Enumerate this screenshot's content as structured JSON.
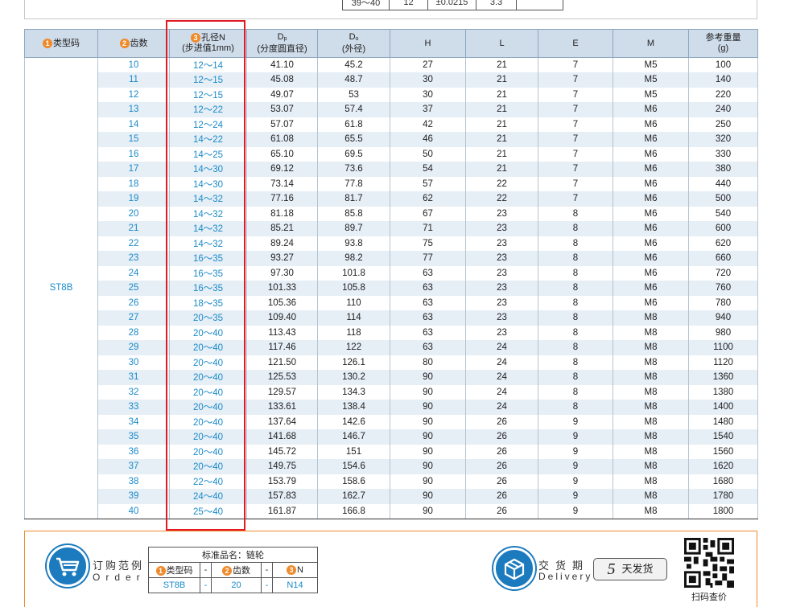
{
  "top_table": {
    "cells": [
      "39～40",
      "12",
      "±0.0215",
      "3.3"
    ]
  },
  "header": {
    "badge1": "1",
    "type_code": "类型码",
    "badge2": "2",
    "teeth": "齿数",
    "badge3": "3",
    "bore": "孔径N",
    "bore_sub": "(步进值1mm)",
    "dp": "D",
    "dp_sub": "p",
    "dp_desc": "(分度圆直径)",
    "do": "D",
    "do_sub": "o",
    "do_desc": "(外径)",
    "h": "H",
    "l": "L",
    "e": "E",
    "m": "M",
    "weight": "参考重量",
    "weight_unit": "(g)"
  },
  "type_value": "ST8B",
  "rows": [
    [
      "10",
      "12～14",
      "41.10",
      "45.2",
      "27",
      "21",
      "7",
      "M5",
      "100"
    ],
    [
      "11",
      "12～15",
      "45.08",
      "48.7",
      "30",
      "21",
      "7",
      "M5",
      "140"
    ],
    [
      "12",
      "12～15",
      "49.07",
      "53",
      "30",
      "21",
      "7",
      "M5",
      "220"
    ],
    [
      "13",
      "12～22",
      "53.07",
      "57.4",
      "37",
      "21",
      "7",
      "M6",
      "240"
    ],
    [
      "14",
      "12～24",
      "57.07",
      "61.8",
      "42",
      "21",
      "7",
      "M6",
      "250"
    ],
    [
      "15",
      "14～22",
      "61.08",
      "65.5",
      "46",
      "21",
      "7",
      "M6",
      "320"
    ],
    [
      "16",
      "14～25",
      "65.10",
      "69.5",
      "50",
      "21",
      "7",
      "M6",
      "330"
    ],
    [
      "17",
      "14～30",
      "69.12",
      "73.6",
      "54",
      "21",
      "7",
      "M6",
      "380"
    ],
    [
      "18",
      "14～30",
      "73.14",
      "77.8",
      "57",
      "22",
      "7",
      "M6",
      "440"
    ],
    [
      "19",
      "14～32",
      "77.16",
      "81.7",
      "62",
      "22",
      "7",
      "M6",
      "500"
    ],
    [
      "20",
      "14～32",
      "81.18",
      "85.8",
      "67",
      "23",
      "8",
      "M6",
      "540"
    ],
    [
      "21",
      "14～32",
      "85.21",
      "89.7",
      "71",
      "23",
      "8",
      "M6",
      "600"
    ],
    [
      "22",
      "14～32",
      "89.24",
      "93.8",
      "75",
      "23",
      "8",
      "M6",
      "620"
    ],
    [
      "23",
      "16～35",
      "93.27",
      "98.2",
      "77",
      "23",
      "8",
      "M6",
      "660"
    ],
    [
      "24",
      "16～35",
      "97.30",
      "101.8",
      "63",
      "23",
      "8",
      "M6",
      "720"
    ],
    [
      "25",
      "16～35",
      "101.33",
      "105.8",
      "63",
      "23",
      "8",
      "M6",
      "760"
    ],
    [
      "26",
      "18～35",
      "105.36",
      "110",
      "63",
      "23",
      "8",
      "M6",
      "780"
    ],
    [
      "27",
      "20～35",
      "109.40",
      "114",
      "63",
      "23",
      "8",
      "M8",
      "940"
    ],
    [
      "28",
      "20～40",
      "113.43",
      "118",
      "63",
      "23",
      "8",
      "M8",
      "980"
    ],
    [
      "29",
      "20～40",
      "117.46",
      "122",
      "63",
      "24",
      "8",
      "M8",
      "1100"
    ],
    [
      "30",
      "20～40",
      "121.50",
      "126.1",
      "80",
      "24",
      "8",
      "M8",
      "1120"
    ],
    [
      "31",
      "20～40",
      "125.53",
      "130.2",
      "90",
      "24",
      "8",
      "M8",
      "1360"
    ],
    [
      "32",
      "20～40",
      "129.57",
      "134.3",
      "90",
      "24",
      "8",
      "M8",
      "1380"
    ],
    [
      "33",
      "20～40",
      "133.61",
      "138.4",
      "90",
      "24",
      "8",
      "M8",
      "1400"
    ],
    [
      "34",
      "20～40",
      "137.64",
      "142.6",
      "90",
      "26",
      "9",
      "M8",
      "1480"
    ],
    [
      "35",
      "20～40",
      "141.68",
      "146.7",
      "90",
      "26",
      "9",
      "M8",
      "1540"
    ],
    [
      "36",
      "20～40",
      "145.72",
      "151",
      "90",
      "26",
      "9",
      "M8",
      "1560"
    ],
    [
      "37",
      "20～40",
      "149.75",
      "154.6",
      "90",
      "26",
      "9",
      "M8",
      "1620"
    ],
    [
      "38",
      "22～40",
      "153.79",
      "158.6",
      "90",
      "26",
      "9",
      "M8",
      "1680"
    ],
    [
      "39",
      "24～40",
      "157.83",
      "162.7",
      "90",
      "26",
      "9",
      "M8",
      "1780"
    ],
    [
      "40",
      "25～40",
      "161.87",
      "166.8",
      "90",
      "26",
      "9",
      "M8",
      "1800"
    ]
  ],
  "order": {
    "title": "订购范例",
    "subtitle": "Order",
    "standard_name": "标准品名：链轮",
    "h1": "类型码",
    "h2": "齿数",
    "h3": "N",
    "dash": "-",
    "v1": "ST8B",
    "v2": "20",
    "v3": "N14"
  },
  "delivery": {
    "title": "交货期",
    "subtitle": "Delivery",
    "days": "5",
    "days_label": "天发货"
  },
  "qr_label": "扫码查价",
  "colors": {
    "accent_orange": "#f08a28",
    "header_blue": "#cfdcea",
    "value_blue": "#1a8ac8",
    "highlight_red": "#e21b23"
  }
}
